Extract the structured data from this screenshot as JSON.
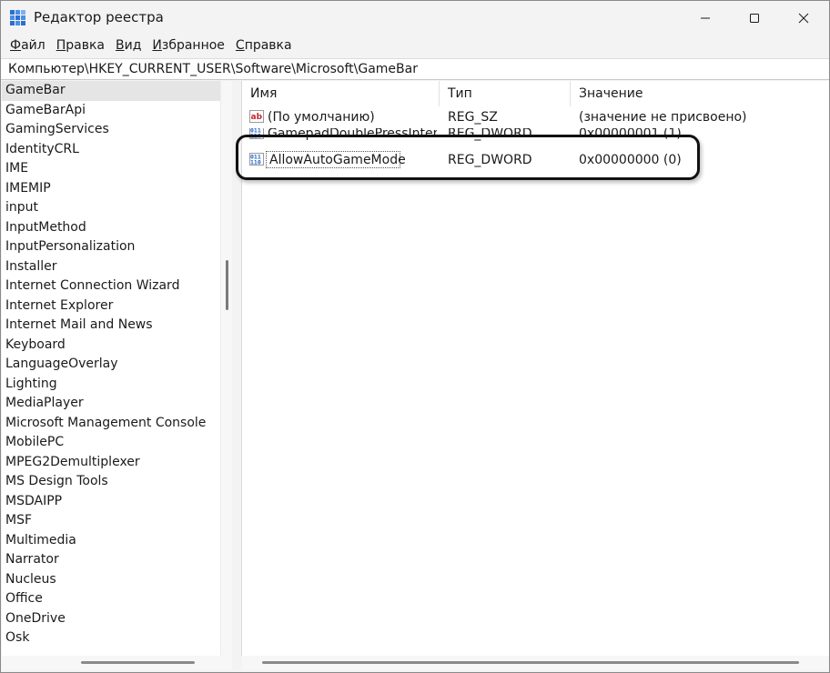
{
  "window": {
    "title": "Редактор реестра"
  },
  "menu": {
    "items": [
      {
        "mnemonic": "Ф",
        "rest": "айл"
      },
      {
        "mnemonic": "П",
        "rest": "равка"
      },
      {
        "mnemonic": "В",
        "rest": "ид"
      },
      {
        "mnemonic": "И",
        "rest": "збранное"
      },
      {
        "mnemonic": "С",
        "rest": "правка"
      }
    ]
  },
  "address": {
    "path": "Компьютер\\HKEY_CURRENT_USER\\Software\\Microsoft\\GameBar"
  },
  "tree": {
    "selected": "GameBar",
    "items": [
      "GameBar",
      "GameBarApi",
      "GamingServices",
      "IdentityCRL",
      "IME",
      "IMEMIP",
      "input",
      "InputMethod",
      "InputPersonalization",
      "Installer",
      "Internet Connection Wizard",
      "Internet Explorer",
      "Internet Mail and News",
      "Keyboard",
      "LanguageOverlay",
      "Lighting",
      "MediaPlayer",
      "Microsoft Management Console",
      "MobilePC",
      "MPEG2Demultiplexer",
      "MS Design Tools",
      "MSDAIPP",
      "MSF",
      "Multimedia",
      "Narrator",
      "Nucleus",
      "Office",
      "OneDrive",
      "Osk"
    ]
  },
  "list": {
    "columns": {
      "name": "Имя",
      "type": "Тип",
      "value": "Значение"
    },
    "rows": [
      {
        "icon": "string-value-icon",
        "name": "(По умолчанию)",
        "type": "REG_SZ",
        "value": "(значение не присвоено)"
      },
      {
        "icon": "binary-value-icon",
        "name": "GamepadDoublePressInterv...",
        "type": "REG_DWORD",
        "value": "0x00000001 (1)"
      },
      {
        "icon": "binary-value-icon",
        "name": "AllowAutoGameMode",
        "type": "REG_DWORD",
        "value": "0x00000000 (0)"
      }
    ]
  },
  "colors": {
    "selection": "#e5e5e5",
    "icon_blue": "#1f5fc4",
    "icon_red": "#c4262e",
    "highlight_ring": "#111111"
  }
}
